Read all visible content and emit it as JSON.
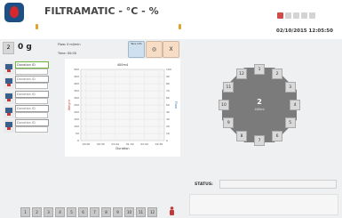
{
  "app": {
    "title": "FILTRAMATIC - °C - %",
    "datetime": "02/10/2015 12:05:50"
  },
  "weight": {
    "scale_label": "2",
    "value": "0 g",
    "flow_label": "Flow: 0 ml/min",
    "time_label": "Time: 00:00"
  },
  "toolbar": {
    "info_label": "Tare Info",
    "target_label": "◎",
    "close_label": "X"
  },
  "channels": [
    {
      "label": "Donation ID",
      "active": true
    },
    {
      "label": "Donation ID",
      "active": false
    },
    {
      "label": "Donation ID",
      "active": false
    },
    {
      "label": "Donation ID",
      "active": false
    },
    {
      "label": "Donation ID",
      "active": false
    }
  ],
  "chart_data": {
    "type": "line",
    "title": "400m4",
    "xlabel": "Duration",
    "ylabel_left": "Weight",
    "ylabel_right": "Flow",
    "x_ticks": [
      "00:00",
      "00:30",
      "01:00",
      "01:30",
      "02:00",
      "02:30"
    ],
    "y_left_ticks": [
      "500",
      "450",
      "400",
      "350",
      "300",
      "250",
      "200",
      "150",
      "100",
      "50",
      "0"
    ],
    "y_right_ticks": [
      "100",
      "90",
      "80",
      "70",
      "60",
      "50",
      "40",
      "30",
      "20",
      "10",
      "0"
    ],
    "series": []
  },
  "carousel": {
    "slots": [
      "1",
      "2",
      "3",
      "4",
      "5",
      "6",
      "7",
      "8",
      "9",
      "10",
      "11",
      "12"
    ],
    "center_value": "2",
    "center_label": "400ml"
  },
  "status": {
    "label": "STATUS:"
  },
  "pager": {
    "pages": [
      "1",
      "2",
      "3",
      "4",
      "5",
      "6",
      "7",
      "8",
      "9",
      "10",
      "11",
      "12"
    ]
  }
}
